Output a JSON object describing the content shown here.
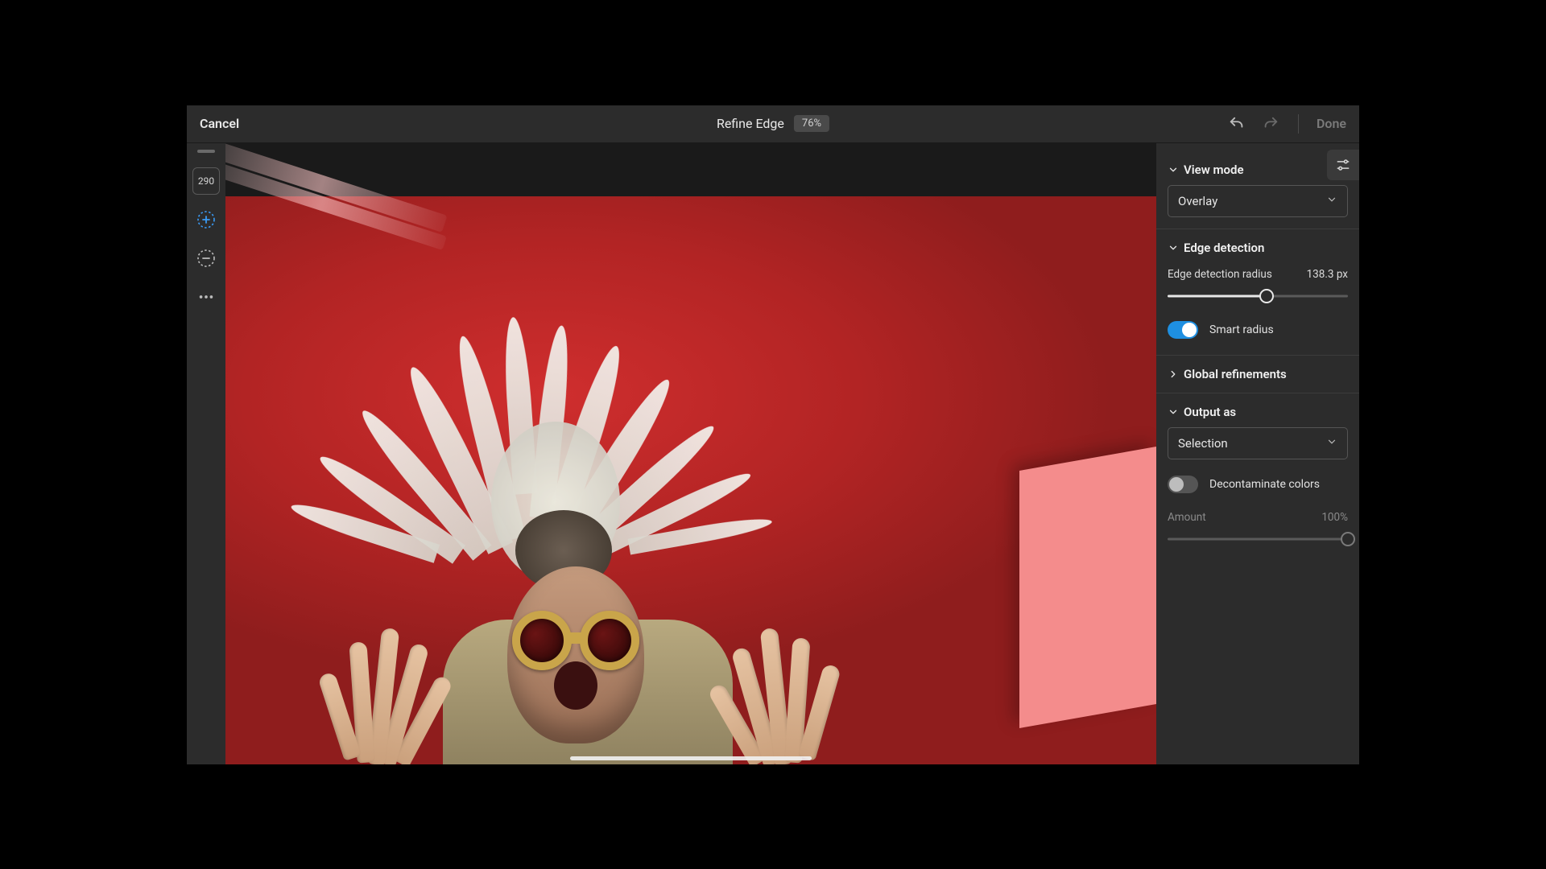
{
  "header": {
    "cancel": "Cancel",
    "title": "Refine Edge",
    "zoom": "76%",
    "done": "Done"
  },
  "toolbar": {
    "brush_size": "290"
  },
  "panel": {
    "view_mode": {
      "title": "View mode",
      "value": "Overlay"
    },
    "edge_detection": {
      "title": "Edge detection",
      "radius_label": "Edge detection radius",
      "radius_value": "138.3 px",
      "radius_percent": 55,
      "smart_radius_label": "Smart radius",
      "smart_radius_on": true
    },
    "global_refinements": {
      "title": "Global refinements"
    },
    "output": {
      "title": "Output as",
      "value": "Selection",
      "decon_label": "Decontaminate colors",
      "decon_on": false,
      "amount_label": "Amount",
      "amount_value": "100%",
      "amount_percent": 100
    }
  }
}
